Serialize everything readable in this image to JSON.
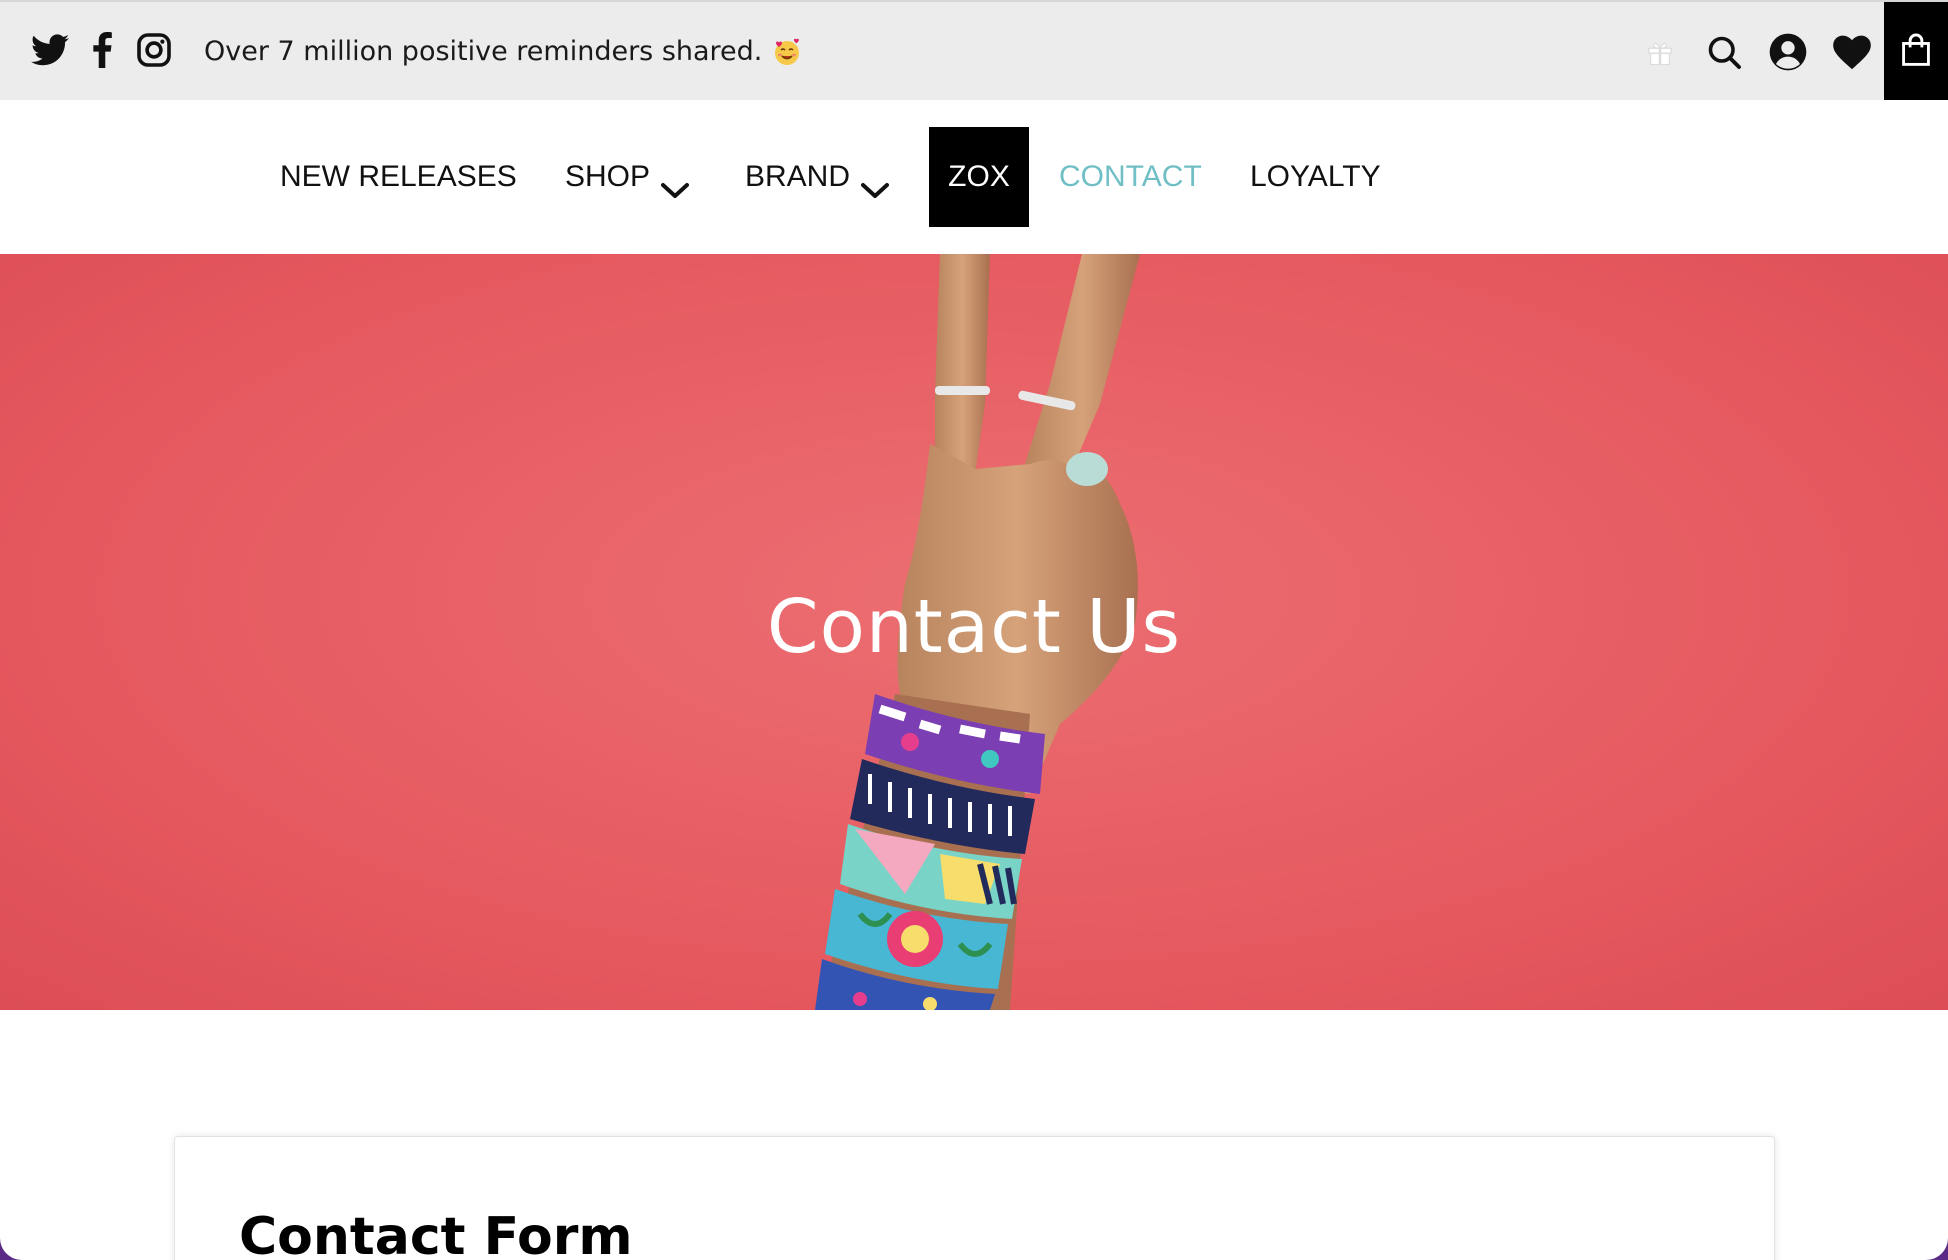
{
  "announcement": "Over 7 million positive reminders shared.",
  "social": [
    {
      "name": "twitter-icon"
    },
    {
      "name": "facebook-icon"
    },
    {
      "name": "instagram-icon"
    }
  ],
  "nav": {
    "new_releases": "NEW RELEASES",
    "shop": "SHOP",
    "brand": "BRAND",
    "zox": "ZOX",
    "contact": "CONTACT",
    "loyalty": "LOYALTY"
  },
  "hero": {
    "title": "Contact Us"
  },
  "card": {
    "title": "Contact Form"
  },
  "colors": {
    "topbar_bg": "#ececec",
    "accent_contact": "#6fbfc5",
    "hero_bg": "#e4575d",
    "frame": "#5a2a86"
  }
}
